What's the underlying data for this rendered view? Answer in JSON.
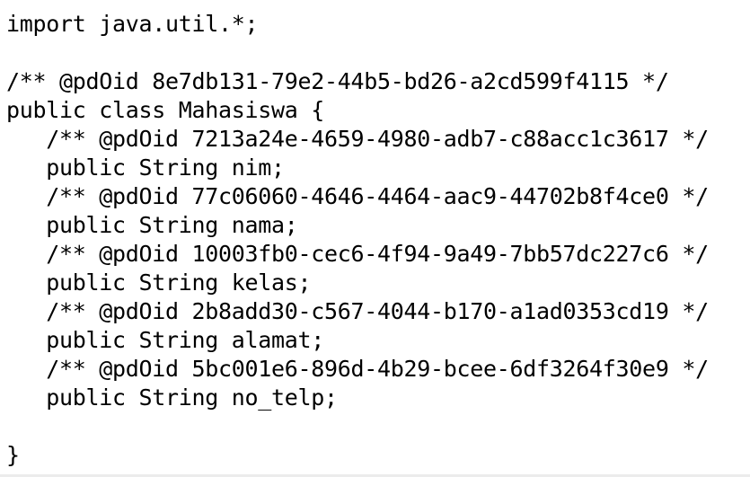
{
  "code": {
    "lines": [
      "import java.util.*;",
      "",
      "/** @pdOid 8e7db131-79e2-44b5-bd26-a2cd599f4115 */",
      "public class Mahasiswa {",
      "   /** @pdOid 7213a24e-4659-4980-adb7-c88acc1c3617 */",
      "   public String nim;",
      "   /** @pdOid 77c06060-4646-4464-aac9-44702b8f4ce0 */",
      "   public String nama;",
      "   /** @pdOid 10003fb0-cec6-4f94-9a49-7bb57dc227c6 */",
      "   public String kelas;",
      "   /** @pdOid 2b8add30-c567-4044-b170-a1ad0353cd19 */",
      "   public String alamat;",
      "   /** @pdOid 5bc001e6-896d-4b29-bcee-6df3264f30e9 */",
      "   public String no_telp;",
      "",
      "}"
    ]
  },
  "colors": {
    "text": "#000000",
    "background": "#ffffff"
  }
}
